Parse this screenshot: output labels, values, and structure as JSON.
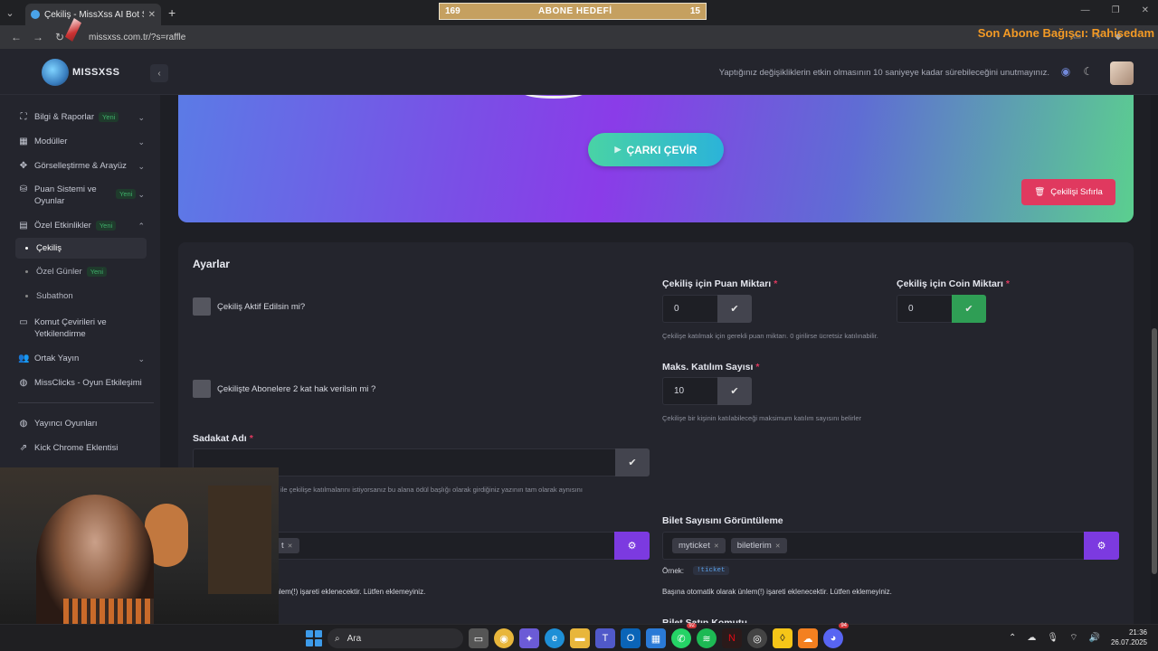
{
  "browser": {
    "tab_title": "Çekiliş - MissXss AI Bot System",
    "url": "missxss.com.tr/?s=raffle",
    "goal": {
      "left": "169",
      "center": "ABONE HEDEFİ",
      "right": "15"
    },
    "donor_overlay": "Son Abone Bağışcı: Rahisedam"
  },
  "header": {
    "brand": "MISSXSS",
    "notice": "Yaptığınız değişikliklerin etkin olmasının 10 saniyeye kadar sürebileceğini unutmayınız."
  },
  "sidebar": {
    "badge": "Yeni",
    "items": [
      {
        "label": "Bilgi & Raporlar"
      },
      {
        "label": "Modüller"
      },
      {
        "label": "Görselleştirme & Arayüz"
      },
      {
        "label": "Puan Sistemi ve Oyunlar"
      },
      {
        "label": "Özel Etkinlikler"
      },
      {
        "label": "Komut Çevirileri ve Yetkilendirme"
      },
      {
        "label": "Ortak Yayın"
      },
      {
        "label": "MissClicks - Oyun Etkileşimi"
      },
      {
        "label": "Yayıncı Oyunları"
      },
      {
        "label": "Kick Chrome Eklentisi"
      }
    ],
    "subitems": [
      {
        "label": "Çekiliş"
      },
      {
        "label": "Özel Günler"
      },
      {
        "label": "Subathon"
      }
    ]
  },
  "hero": {
    "spin_label": "ÇARKI ÇEVİR",
    "reset_label": "Çekilişi Sıfırla"
  },
  "settings": {
    "title": "Ayarlar",
    "active_check": "Çekiliş Aktif Edilsin mi?",
    "sub_double_check": "Çekilişte Abonelere 2 kat hak verilsin mi ?",
    "points_label": "Çekiliş için Puan Miktarı",
    "points_value": "0",
    "points_help": "Çekilişe katılmak için gerekli puan miktarı. 0 girilirse ücretsiz katılınabilir.",
    "coin_label": "Çekiliş için Coin Miktarı",
    "coin_value": "0",
    "max_label": "Maks. Katılım Sayısı",
    "max_value": "10",
    "max_help": "Çekilişe bir kişinin katılabileceği maksimum katılım sayısını belirler",
    "loyalty_label": "Sadakat Adı",
    "loyalty_value": "",
    "loyalty_help_link": "mi",
    "loyalty_help": "ile çekilişe katılmalarını istiyorsanız bu alana ödül başlığı olarak girdiğiniz yazının tam olarak aynısını",
    "left_tag_partial": "t",
    "left_note": "ünlem(!) işareti eklenecektir. Lütfen eklemeyiniz.",
    "ticket_label": "Bilet Sayısını Görüntüleme",
    "ticket_tags": [
      "myticket",
      "biletlerim"
    ],
    "example_label": "Örnek:",
    "example_code": "!ticket",
    "ticket_note": "Başına otomatik olarak ünlem(!) işareti eklenecektir. Lütfen eklemeyiniz.",
    "next_label_partial": "Bilet Satın Komutu"
  },
  "taskbar": {
    "search_placeholder": "Ara",
    "whatsapp_badge": "92",
    "discord_badge": "94",
    "time": "21:36",
    "date": "26.07.2025"
  }
}
